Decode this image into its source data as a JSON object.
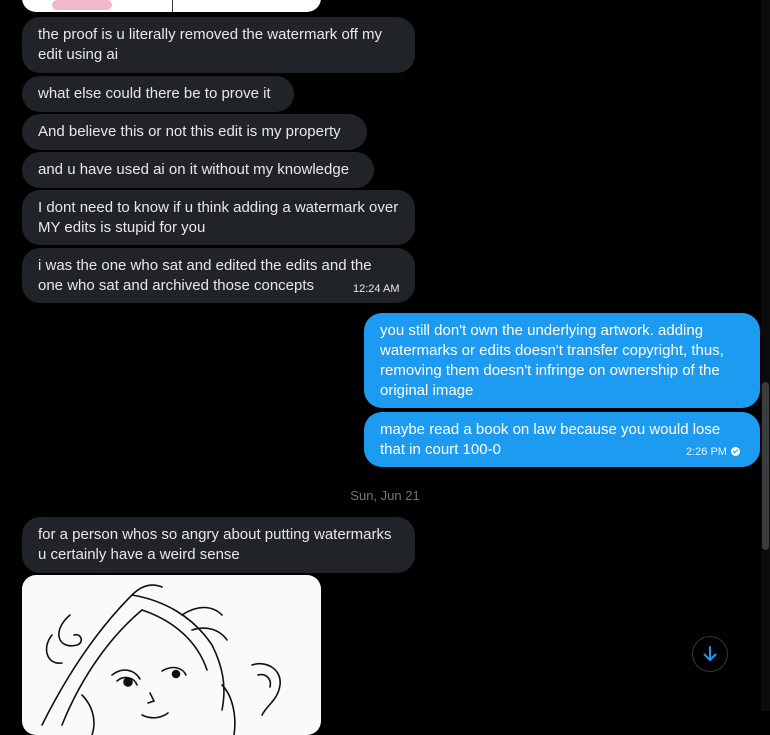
{
  "messages": [
    {
      "side": "in",
      "text": "the proof is u literally removed the watermark off my edit using ai"
    },
    {
      "side": "in",
      "text": "what else could there be to prove it"
    },
    {
      "side": "in",
      "text": "And believe this or not this edit is my property"
    },
    {
      "side": "in",
      "text": "and u have used ai on it without my knowledge"
    },
    {
      "side": "in",
      "text": "I dont need to know if u think adding a watermark over MY edits is stupid for you"
    },
    {
      "side": "in",
      "text": "i was the one who sat and edited the edits and the one who sat and archived those concepts",
      "time": "12:24 AM"
    },
    {
      "side": "out",
      "text": "you still don't own the underlying artwork. adding watermarks or edits doesn't transfer copyright, thus, removing them doesn't infringe on ownership of the original image"
    },
    {
      "side": "out",
      "text": "maybe read a book on law because you would lose that in court 100-0",
      "time": "2:26 PM"
    },
    {
      "side": "in",
      "text": "for a person whos so angry about putting watermarks u certainly have a weird sense"
    }
  ],
  "date_separator": "Sun, Jun 21",
  "icons": {
    "read_receipt": "check-circle-icon",
    "scroll_down": "arrow-down-icon"
  },
  "colors": {
    "background": "#000000",
    "incoming_bubble": "#202327",
    "outgoing_bubble": "#1d9bf0",
    "text": "#e7e9ea",
    "muted": "#71767b"
  }
}
